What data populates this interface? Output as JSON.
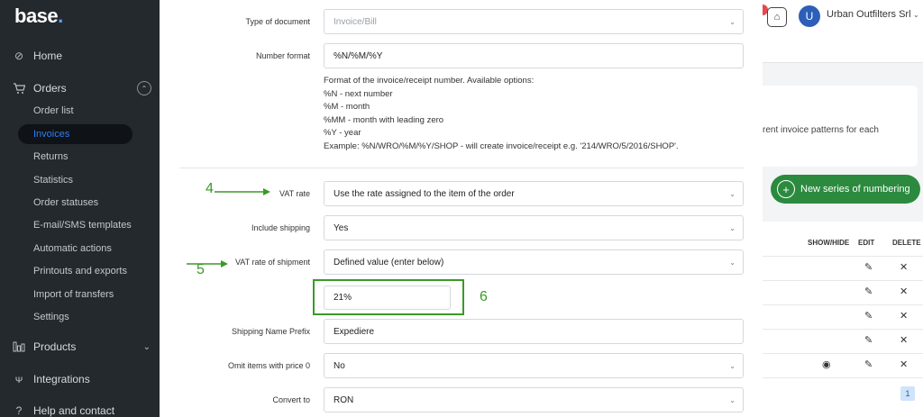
{
  "sidebar": {
    "logo_text": "base",
    "logo_dot": ".",
    "items": [
      {
        "label": "Home",
        "icon": "compass-icon"
      },
      {
        "label": "Orders",
        "icon": "cart-icon"
      },
      {
        "label": "Products",
        "icon": "products-icon"
      },
      {
        "label": "Integrations",
        "icon": "plug-icon"
      },
      {
        "label": "Help and contact",
        "icon": "help-icon"
      }
    ],
    "orders_sub": [
      "Order list",
      "Invoices",
      "Returns",
      "Statistics",
      "Order statuses",
      "E-mail/SMS templates",
      "Automatic actions",
      "Printouts and exports",
      "Import of transfers",
      "Settings"
    ],
    "active_sub": "Invoices"
  },
  "header": {
    "avatar_letter": "U",
    "company": "Urban Outfilters Srl"
  },
  "background": {
    "info_text": "rent invoice patterns for each",
    "new_series_label": "New series of numbering",
    "columns": [
      "SHOW/HIDE",
      "EDIT",
      "DELETE"
    ],
    "page_number": "1"
  },
  "form": {
    "type_of_document": {
      "label": "Type of document",
      "value": "Invoice/Bill"
    },
    "number_format": {
      "label": "Number format",
      "value": "%N/%M/%Y",
      "help": [
        "Format of the invoice/receipt number. Available options:",
        "%N - next number",
        "%M - month",
        "%MM - month with leading zero",
        "%Y - year",
        "Example: %N/WRO/%M/%Y/SHOP - will create invoice/receipt e.g. '214/WRO/5/2016/SHOP'."
      ]
    },
    "vat_rate": {
      "label": "VAT rate",
      "value": "Use the rate assigned to the item of the order"
    },
    "include_shipping": {
      "label": "Include shipping",
      "value": "Yes"
    },
    "vat_rate_shipment": {
      "label": "VAT rate of shipment",
      "value": "Defined value (enter below)"
    },
    "shipment_value": "21%",
    "shipping_name_prefix": {
      "label": "Shipping Name Prefix",
      "value": "Expediere"
    },
    "omit_items": {
      "label": "Omit items with price 0",
      "value": "No"
    },
    "convert_to": {
      "label": "Convert to",
      "value": "RON"
    }
  },
  "annotations": {
    "n4": "4",
    "n5": "5",
    "n6": "6",
    "color": "#3a9a28"
  }
}
